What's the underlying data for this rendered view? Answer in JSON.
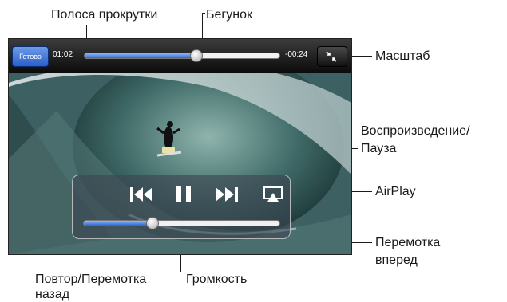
{
  "player": {
    "done_label": "Готово",
    "elapsed": "01:02",
    "remaining": "-00:24",
    "scrub_progress": 0.57,
    "volume_level": 0.35,
    "accent_color": "#2c66d4",
    "icons": {
      "scale": "shrink-arrows-icon",
      "previous": "skip-back-icon",
      "play_pause": "pause-icon",
      "next": "skip-forward-icon",
      "airplay": "airplay-icon"
    }
  },
  "annotations": {
    "scrubber_bar": "Полоса прокрутки",
    "playhead": "Бегунок",
    "scale": "Масштаб",
    "play_pause_line1": "Воспроизведение/",
    "play_pause_line2": "Пауза",
    "airplay": "AirPlay",
    "next_line1": "Перемотка",
    "next_line2": "вперед",
    "prev_line1": "Повтор/Перемотка",
    "prev_line2": "назад",
    "volume": "Громкость"
  }
}
